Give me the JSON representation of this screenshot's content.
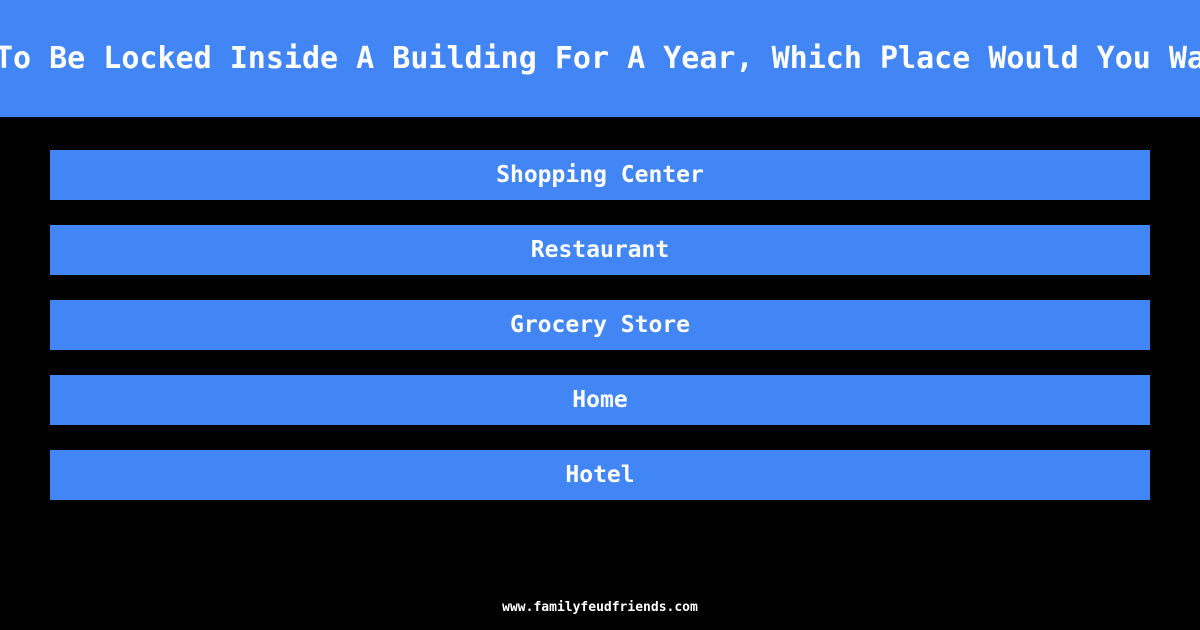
{
  "page": {
    "background_color": "#000000",
    "accent_color": "#4285f4",
    "text_color": "#ffffff"
  },
  "header": {
    "question": "Had To Be Locked Inside A Building For A Year, Which Place Would You Want I"
  },
  "answers": [
    {
      "label": "Shopping Center"
    },
    {
      "label": "Restaurant"
    },
    {
      "label": "Grocery Store"
    },
    {
      "label": "Home"
    },
    {
      "label": "Hotel"
    }
  ],
  "footer": {
    "site": "www.familyfeudfriends.com"
  }
}
